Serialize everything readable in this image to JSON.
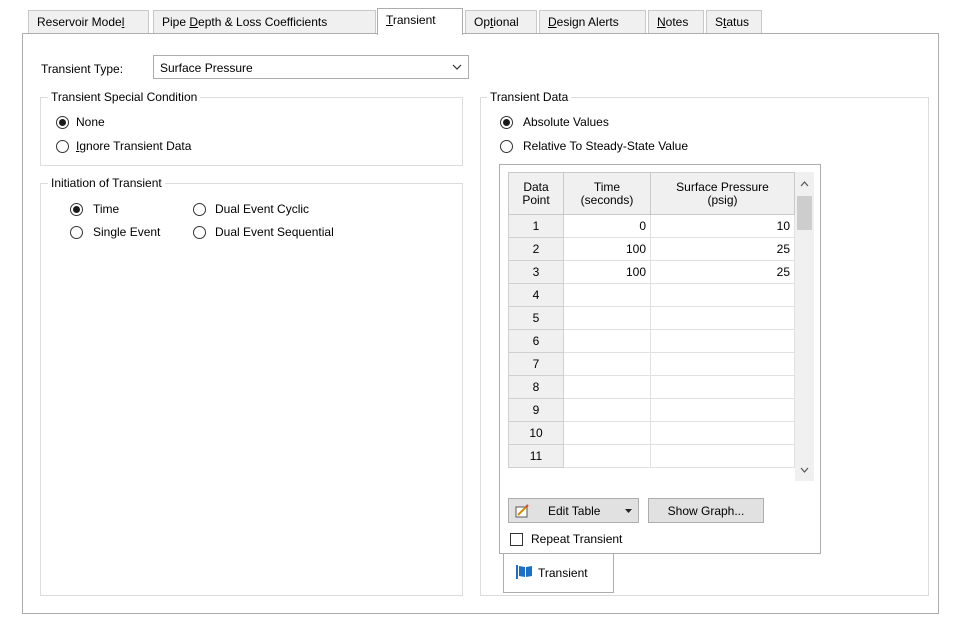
{
  "tabs": [
    {
      "pre": "Reservoir Mode",
      "u": "l",
      "post": ""
    },
    {
      "pre": "Pipe ",
      "u": "D",
      "post": "epth & Loss Coefficients"
    },
    {
      "pre": "",
      "u": "T",
      "post": "ransient"
    },
    {
      "pre": "Op",
      "u": "t",
      "post": "ional"
    },
    {
      "pre": "",
      "u": "D",
      "post": "esign Alerts"
    },
    {
      "pre": "",
      "u": "N",
      "post": "otes"
    },
    {
      "pre": "S",
      "u": "t",
      "post": "atus"
    }
  ],
  "transient_type": {
    "label": "Transient Type:",
    "value": "Surface Pressure"
  },
  "special_condition": {
    "title": "Transient Special Condition",
    "none": "None",
    "ignore_pre": "",
    "ignore_u": "I",
    "ignore_post": "gnore Transient Data",
    "selected": "none"
  },
  "initiation": {
    "title": "Initiation of Transient",
    "time": "Time",
    "single": "Single Event",
    "dual_cyclic": "Dual Event Cyclic",
    "dual_sequential": "Dual Event Sequential",
    "selected": "time"
  },
  "transient_data": {
    "title": "Transient Data",
    "absolute": "Absolute Values",
    "relative": "Relative To Steady-State Value",
    "selected": "absolute"
  },
  "table": {
    "col_point": [
      "Data",
      "Point"
    ],
    "col_time": [
      "Time",
      "(seconds)"
    ],
    "col_pressure": [
      "Surface Pressure",
      "(psig)"
    ],
    "rows": [
      {
        "n": "1",
        "time": "0",
        "pressure": "10"
      },
      {
        "n": "2",
        "time": "100",
        "pressure": "25"
      },
      {
        "n": "3",
        "time": "100",
        "pressure": "25"
      },
      {
        "n": "4",
        "time": "",
        "pressure": ""
      },
      {
        "n": "5",
        "time": "",
        "pressure": ""
      },
      {
        "n": "6",
        "time": "",
        "pressure": ""
      },
      {
        "n": "7",
        "time": "",
        "pressure": ""
      },
      {
        "n": "8",
        "time": "",
        "pressure": ""
      },
      {
        "n": "9",
        "time": "",
        "pressure": ""
      },
      {
        "n": "10",
        "time": "",
        "pressure": ""
      },
      {
        "n": "11",
        "time": "",
        "pressure": ""
      }
    ]
  },
  "buttons": {
    "edit_table": "Edit Table",
    "show_graph": "Show Graph..."
  },
  "repeat_transient": {
    "label": "Repeat Transient",
    "checked": false
  },
  "bottom_tab": {
    "label": "Transient",
    "icon": "transient-flag-icon"
  },
  "colors": {
    "icon_blue": "#1e6fc8",
    "border": "#adadad"
  }
}
